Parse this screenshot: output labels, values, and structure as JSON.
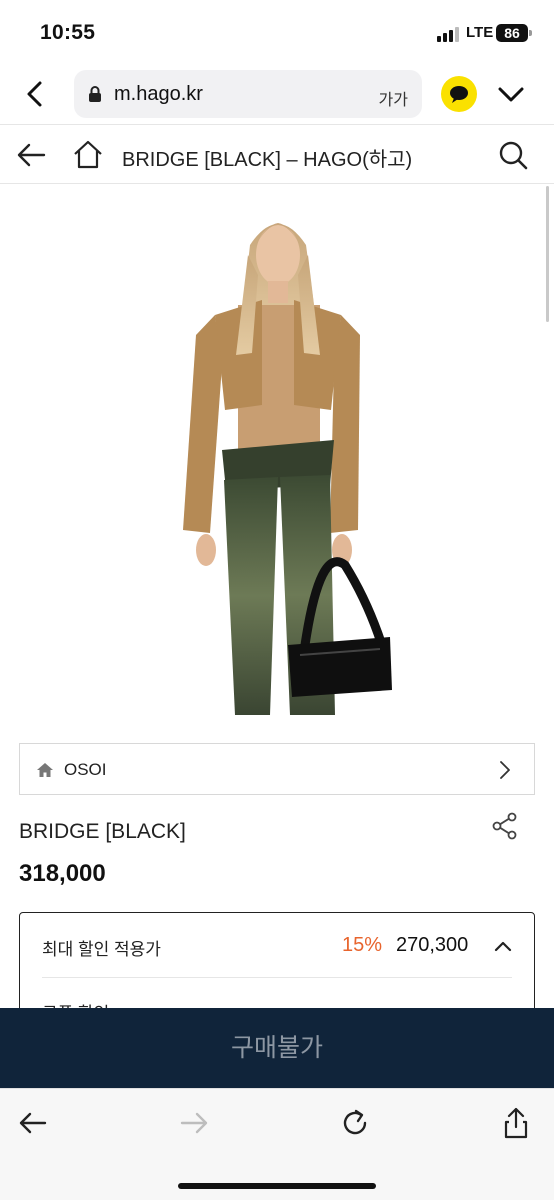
{
  "status_bar": {
    "time": "10:55",
    "network": "LTE",
    "battery": "86"
  },
  "browser": {
    "url": "m.hago.kr",
    "text_size_label": "가가"
  },
  "header": {
    "title": "BRIDGE [BLACK] – HAGO(하고)"
  },
  "brand": {
    "name": "OSOI"
  },
  "product": {
    "name": "BRIDGE [BLACK]",
    "price": "318,000"
  },
  "discount": {
    "label": "최대 할인 적용가",
    "rate": "15%",
    "price": "270,300",
    "coupon_label": "쿠폰 할인"
  },
  "buy_button": {
    "label": "구매불가"
  },
  "colors": {
    "accent_orange": "#e8642d",
    "buy_button_bg": "#10243a",
    "kakao_yellow": "#fae100"
  }
}
